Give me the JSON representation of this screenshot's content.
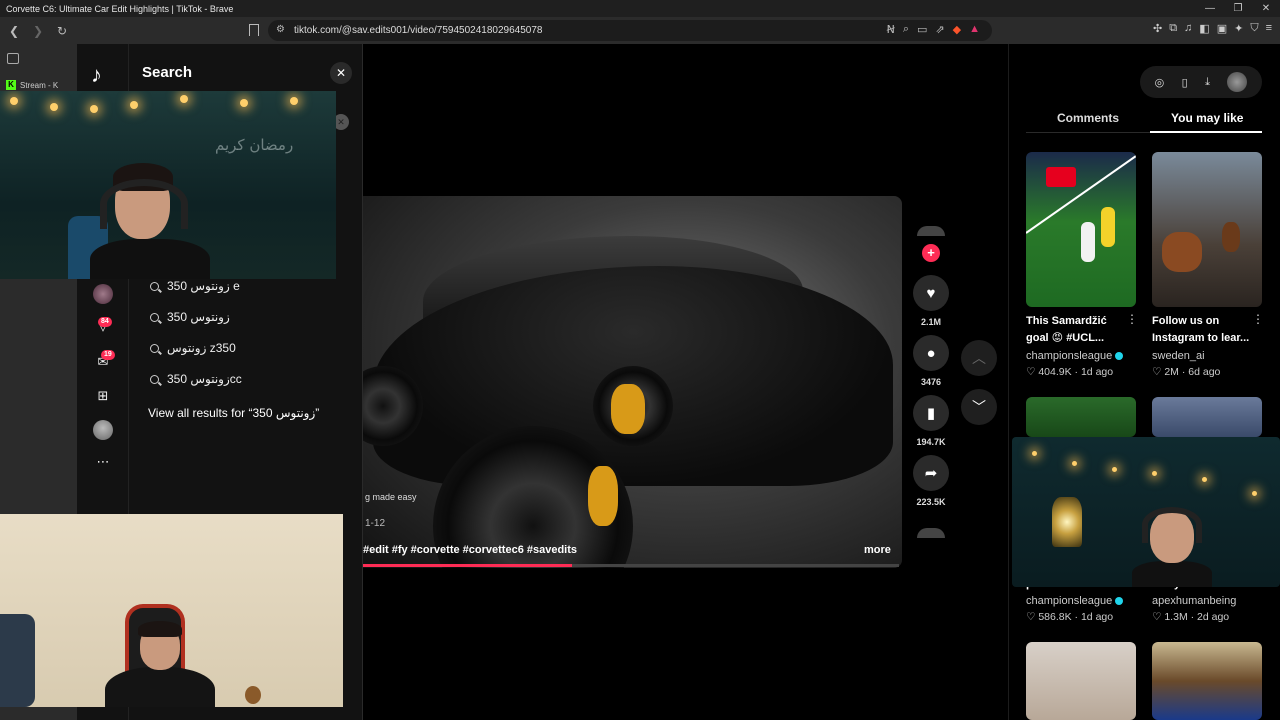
{
  "window": {
    "title": "Corvette C6: Ultimate Car Edit Highlights | TikTok - Brave"
  },
  "browser": {
    "url": "tiktok.com/@sav.edits001/video/7594502418029645078"
  },
  "tabs_sidebar": {
    "stream_tab_label": "Stream - K"
  },
  "search": {
    "title": "Search",
    "suggestions": [
      "زونتوس 350 e",
      "زونتوس 350",
      "زونتوس z350",
      "زونتوس 350cc"
    ],
    "view_all": "View all results for “زونتوس 350”"
  },
  "rail": {
    "activity_badge": "84",
    "messages_badge": "19"
  },
  "video": {
    "caption": "g made easy",
    "date": "1-12",
    "tags": "#edit #fy #corvette #corvettec6 #savedits",
    "more": "more",
    "progress": 0.39
  },
  "actions": {
    "likes": "2.1M",
    "comments": "3476",
    "saves": "194.7K",
    "shares": "223.5K"
  },
  "panel": {
    "tabs": [
      "Comments",
      "You may like"
    ],
    "active_tab": "You may like",
    "recs": [
      {
        "title": "This Samardžić goal 😡 #UCL...",
        "author": "championsleague",
        "verified": true,
        "likes": "404.9K",
        "age": "1d ago"
      },
      {
        "title": "Follow us on Instagram to lear...",
        "author": "sweden_ai",
        "verified": false,
        "likes": "2M",
        "age": "6d ago"
      },
      {
        "title": "performance",
        "author": "championsleague",
        "verified": true,
        "likes": "586.8K",
        "age": "1d ago"
      },
      {
        "title": "lokey",
        "author": "apexhumanbeing",
        "verified": false,
        "likes": "1.3M",
        "age": "2d ago"
      }
    ]
  },
  "webcam": {
    "wall_text": "رمضان كريم"
  },
  "colors": {
    "accent": "#fe2c55",
    "verified": "#20d5ec",
    "caliper": "#d89a18"
  }
}
